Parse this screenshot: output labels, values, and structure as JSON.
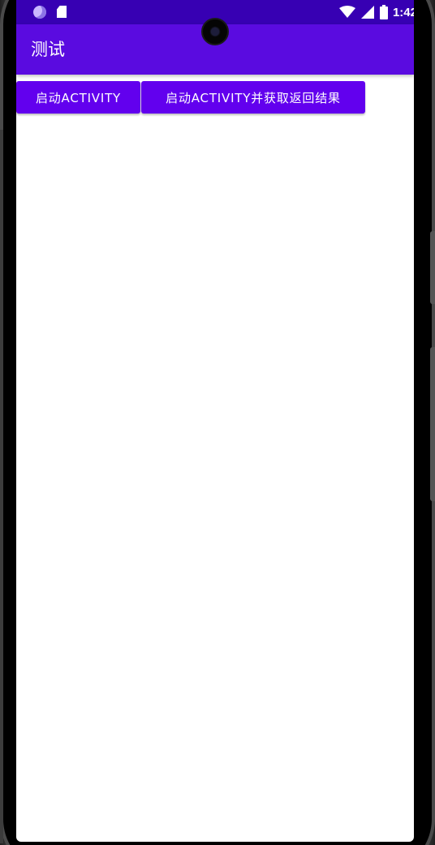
{
  "statusbar": {
    "time": "1:42",
    "left_icons": [
      "moon-icon",
      "sd-card-icon"
    ],
    "right_icons": [
      "wifi-icon",
      "signal-icon",
      "battery-icon"
    ]
  },
  "appbar": {
    "title": "测试"
  },
  "buttons": {
    "start_activity": "启动ACTIVITY",
    "start_activity_for_result": "启动ACTIVITY并获取返回结果"
  },
  "colors": {
    "status_bar": "#3700b3",
    "app_bar": "#5a0be0",
    "button": "#6200ee",
    "background": "#ffffff"
  }
}
